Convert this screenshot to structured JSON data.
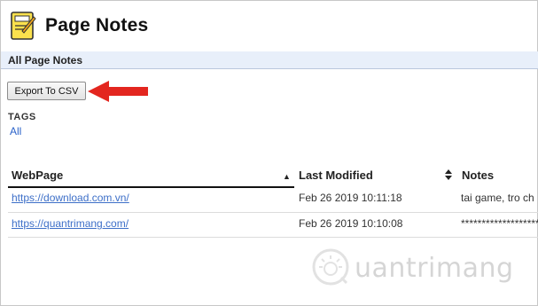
{
  "app": {
    "title": "Page Notes",
    "logo_icon": "notepad-icon"
  },
  "section": {
    "title": "All Page Notes"
  },
  "toolbar": {
    "export_label": "Export To CSV"
  },
  "tags": {
    "label": "TAGS",
    "items": [
      "All"
    ]
  },
  "table": {
    "columns": [
      "WebPage",
      "Last Modified",
      "Notes"
    ],
    "rows": [
      {
        "url": "https://download.com.vn/",
        "modified": "Feb 26 2019 10:11:18",
        "notes": "tai game, tro ch"
      },
      {
        "url": "https://quantrimang.com/",
        "modified": "Feb 26 2019 10:10:08",
        "notes": "**************************"
      }
    ]
  },
  "watermark": {
    "text": "uantrimang"
  },
  "colors": {
    "accent": "#e8effa",
    "link": "#3d6fc8",
    "arrow": "#e3261f"
  }
}
